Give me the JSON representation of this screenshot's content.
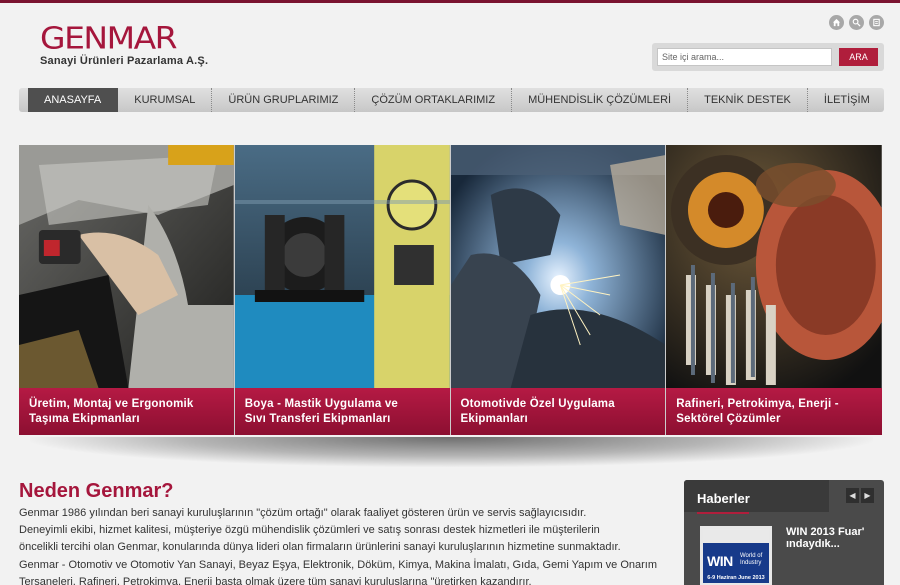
{
  "brand": {
    "name": "GENMAR",
    "tagline": "Sanayi Ürünleri Pazarlama A.Ş.",
    "color": "#a5163c"
  },
  "top_icons": [
    "home-icon",
    "search-icon",
    "sitemap-icon"
  ],
  "search": {
    "placeholder": "Site içi arama...",
    "button_label": "ARA"
  },
  "nav": {
    "items": [
      {
        "label": "ANASAYFA",
        "active": true
      },
      {
        "label": "KURUMSAL"
      },
      {
        "label": "ÜRÜN GRUPLARIMIZ"
      },
      {
        "label": "ÇÖZÜM ORTAKLARIMIZ"
      },
      {
        "label": "MÜHENDİSLİK ÇÖZÜMLERİ"
      },
      {
        "label": "TEKNİK DESTEK"
      },
      {
        "label": "İLETİŞİM"
      }
    ]
  },
  "slides": [
    {
      "line1": "Üretim, Montaj ve Ergonomik",
      "line2": "Taşıma Ekipmanları"
    },
    {
      "line1": "Boya - Mastik Uygulama ve",
      "line2": "Sıvı Transferi Ekipmanları"
    },
    {
      "line1": "Otomotivde Özel Uygulama",
      "line2": "Ekipmanları"
    },
    {
      "line1": "Rafineri, Petrokimya, Enerji -",
      "line2": "Sektörel Çözümler"
    }
  ],
  "why": {
    "title": "Neden Genmar?",
    "lines": [
      "Genmar 1986 yılından beri sanayi kuruluşlarının \"çözüm ortağı\" olarak faaliyet gösteren ürün ve servis sağlayıcısıdır.",
      "Deneyimli ekibi, hizmet kalitesi, müşteriye özgü mühendislik çözümleri ve satış sonrası destek hizmetleri ile müşterilerin",
      "öncelikli tercihi olan Genmar, konularında dünya lideri olan firmaların ürünlerini sanayi kuruluşlarının hizmetine sunmaktadır.",
      "Genmar - Otomotiv ve Otomotiv Yan Sanayi, Beyaz Eşya, Elektronik, Döküm, Kimya, Makina İmalatı, Gıda, Gemi Yapım ve Onarım",
      "Tersaneleri, Rafineri, Petrokimya, Enerji başta olmak üzere tüm sanayi kuruluşlarına \"üretirken kazandırır."
    ]
  },
  "news": {
    "title": "Haberler",
    "prev_icon": "chevron-left-icon",
    "next_icon": "chevron-right-icon",
    "item_text": "WIN 2013 Fuar' ındaydık...",
    "thumb": {
      "big": "WIN",
      "small1": "World of",
      "small2": "Industry",
      "date": "6-9 Haziran June 2013"
    }
  }
}
